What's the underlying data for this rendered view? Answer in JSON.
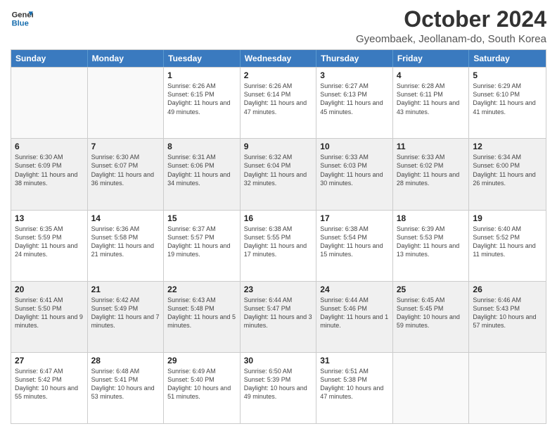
{
  "logo": {
    "line1": "General",
    "line2": "Blue"
  },
  "title": "October 2024",
  "subtitle": "Gyeombaek, Jeollanam-do, South Korea",
  "days_of_week": [
    "Sunday",
    "Monday",
    "Tuesday",
    "Wednesday",
    "Thursday",
    "Friday",
    "Saturday"
  ],
  "weeks": [
    [
      {
        "day": "",
        "info": "",
        "empty": true
      },
      {
        "day": "",
        "info": "",
        "empty": true
      },
      {
        "day": "1",
        "info": "Sunrise: 6:26 AM\nSunset: 6:15 PM\nDaylight: 11 hours and 49 minutes."
      },
      {
        "day": "2",
        "info": "Sunrise: 6:26 AM\nSunset: 6:14 PM\nDaylight: 11 hours and 47 minutes."
      },
      {
        "day": "3",
        "info": "Sunrise: 6:27 AM\nSunset: 6:13 PM\nDaylight: 11 hours and 45 minutes."
      },
      {
        "day": "4",
        "info": "Sunrise: 6:28 AM\nSunset: 6:11 PM\nDaylight: 11 hours and 43 minutes."
      },
      {
        "day": "5",
        "info": "Sunrise: 6:29 AM\nSunset: 6:10 PM\nDaylight: 11 hours and 41 minutes."
      }
    ],
    [
      {
        "day": "6",
        "info": "Sunrise: 6:30 AM\nSunset: 6:09 PM\nDaylight: 11 hours and 38 minutes."
      },
      {
        "day": "7",
        "info": "Sunrise: 6:30 AM\nSunset: 6:07 PM\nDaylight: 11 hours and 36 minutes."
      },
      {
        "day": "8",
        "info": "Sunrise: 6:31 AM\nSunset: 6:06 PM\nDaylight: 11 hours and 34 minutes."
      },
      {
        "day": "9",
        "info": "Sunrise: 6:32 AM\nSunset: 6:04 PM\nDaylight: 11 hours and 32 minutes."
      },
      {
        "day": "10",
        "info": "Sunrise: 6:33 AM\nSunset: 6:03 PM\nDaylight: 11 hours and 30 minutes."
      },
      {
        "day": "11",
        "info": "Sunrise: 6:33 AM\nSunset: 6:02 PM\nDaylight: 11 hours and 28 minutes."
      },
      {
        "day": "12",
        "info": "Sunrise: 6:34 AM\nSunset: 6:00 PM\nDaylight: 11 hours and 26 minutes."
      }
    ],
    [
      {
        "day": "13",
        "info": "Sunrise: 6:35 AM\nSunset: 5:59 PM\nDaylight: 11 hours and 24 minutes."
      },
      {
        "day": "14",
        "info": "Sunrise: 6:36 AM\nSunset: 5:58 PM\nDaylight: 11 hours and 21 minutes."
      },
      {
        "day": "15",
        "info": "Sunrise: 6:37 AM\nSunset: 5:57 PM\nDaylight: 11 hours and 19 minutes."
      },
      {
        "day": "16",
        "info": "Sunrise: 6:38 AM\nSunset: 5:55 PM\nDaylight: 11 hours and 17 minutes."
      },
      {
        "day": "17",
        "info": "Sunrise: 6:38 AM\nSunset: 5:54 PM\nDaylight: 11 hours and 15 minutes."
      },
      {
        "day": "18",
        "info": "Sunrise: 6:39 AM\nSunset: 5:53 PM\nDaylight: 11 hours and 13 minutes."
      },
      {
        "day": "19",
        "info": "Sunrise: 6:40 AM\nSunset: 5:52 PM\nDaylight: 11 hours and 11 minutes."
      }
    ],
    [
      {
        "day": "20",
        "info": "Sunrise: 6:41 AM\nSunset: 5:50 PM\nDaylight: 11 hours and 9 minutes."
      },
      {
        "day": "21",
        "info": "Sunrise: 6:42 AM\nSunset: 5:49 PM\nDaylight: 11 hours and 7 minutes."
      },
      {
        "day": "22",
        "info": "Sunrise: 6:43 AM\nSunset: 5:48 PM\nDaylight: 11 hours and 5 minutes."
      },
      {
        "day": "23",
        "info": "Sunrise: 6:44 AM\nSunset: 5:47 PM\nDaylight: 11 hours and 3 minutes."
      },
      {
        "day": "24",
        "info": "Sunrise: 6:44 AM\nSunset: 5:46 PM\nDaylight: 11 hours and 1 minute."
      },
      {
        "day": "25",
        "info": "Sunrise: 6:45 AM\nSunset: 5:45 PM\nDaylight: 10 hours and 59 minutes."
      },
      {
        "day": "26",
        "info": "Sunrise: 6:46 AM\nSunset: 5:43 PM\nDaylight: 10 hours and 57 minutes."
      }
    ],
    [
      {
        "day": "27",
        "info": "Sunrise: 6:47 AM\nSunset: 5:42 PM\nDaylight: 10 hours and 55 minutes."
      },
      {
        "day": "28",
        "info": "Sunrise: 6:48 AM\nSunset: 5:41 PM\nDaylight: 10 hours and 53 minutes."
      },
      {
        "day": "29",
        "info": "Sunrise: 6:49 AM\nSunset: 5:40 PM\nDaylight: 10 hours and 51 minutes."
      },
      {
        "day": "30",
        "info": "Sunrise: 6:50 AM\nSunset: 5:39 PM\nDaylight: 10 hours and 49 minutes."
      },
      {
        "day": "31",
        "info": "Sunrise: 6:51 AM\nSunset: 5:38 PM\nDaylight: 10 hours and 47 minutes."
      },
      {
        "day": "",
        "info": "",
        "empty": true
      },
      {
        "day": "",
        "info": "",
        "empty": true
      }
    ]
  ]
}
